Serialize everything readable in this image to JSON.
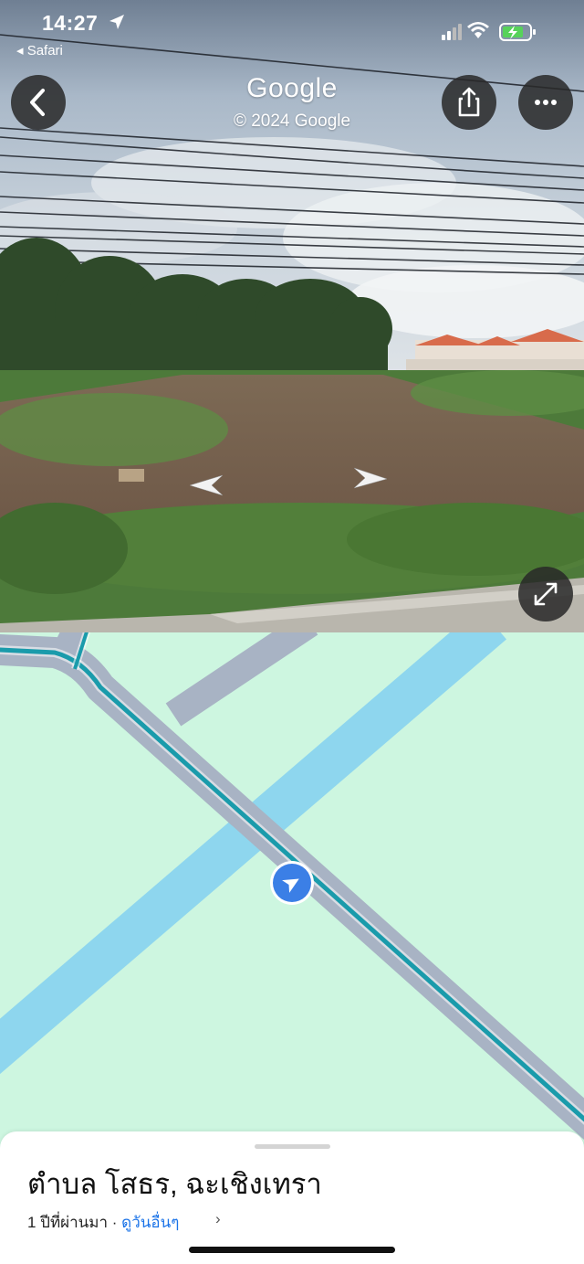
{
  "status_bar": {
    "time": "14:27",
    "back_app_label": "◂ Safari",
    "battery_color": "#57d25a"
  },
  "street_view": {
    "logo_text": "Google",
    "copyright_text": "© 2024 Google",
    "buttons": [
      "back-icon",
      "share-icon",
      "more-icon",
      "expand-icon"
    ]
  },
  "map": {
    "colors": {
      "land": "#cdf6e0",
      "water": "#8ed6ee",
      "road": "#a8b3c4",
      "route": "#1a9bab",
      "location": "#3b7fe6"
    }
  },
  "place": {
    "title": "ตำบล โสธร, ฉะเชิงเทรา",
    "subtitle_prefix": "1 ปีที่ผ่านมา · ",
    "link_text": "ดูวันอื่นๆ",
    "chevron": "›"
  }
}
